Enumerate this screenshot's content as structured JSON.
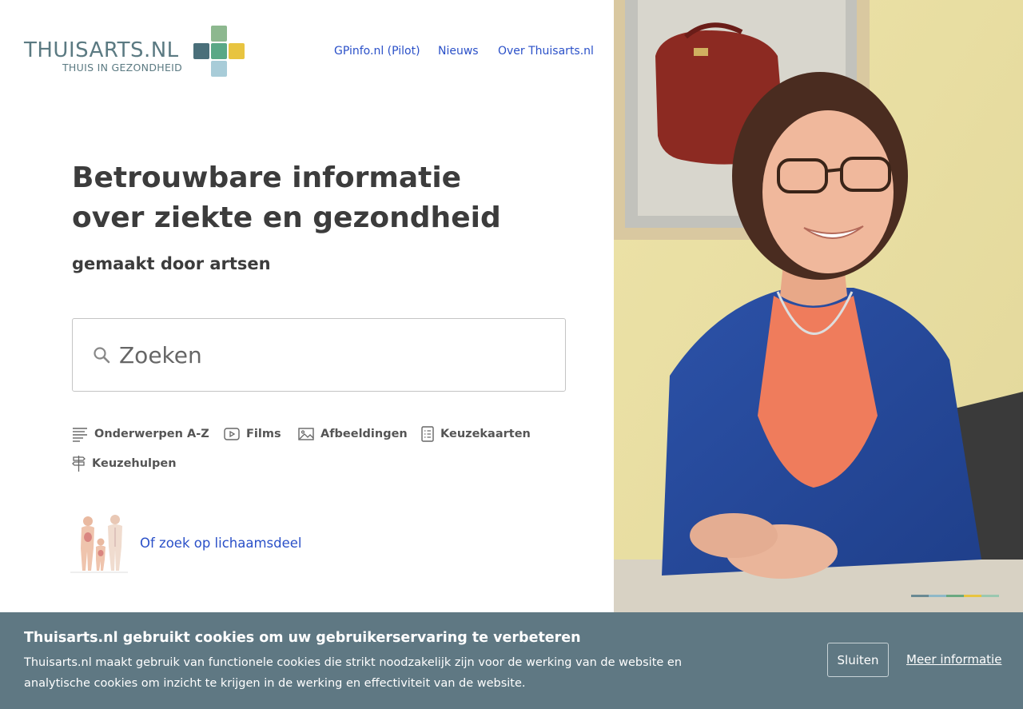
{
  "header": {
    "logo": {
      "wordmark": "THUISARTS.NL",
      "tagline": "THUIS IN GEZONDHEID",
      "cross_colors": [
        "#8db88f",
        "#4a6f7a",
        "#6fa8b8",
        "#5aa886",
        "#e8c440",
        "#a8ccd8"
      ]
    },
    "nav": [
      {
        "label": "GPinfo.nl (Pilot)"
      },
      {
        "label": "Nieuws"
      },
      {
        "label": "Over Thuisarts.nl"
      }
    ]
  },
  "hero": {
    "title_line1": "Betrouwbare informatie",
    "title_line2": "over ziekte en gezondheid",
    "subtitle": "gemaakt door artsen"
  },
  "search": {
    "placeholder": "Zoeken",
    "icon": "search-icon"
  },
  "quick_links": [
    {
      "label": "Onderwerpen A-Z",
      "icon": "list-icon"
    },
    {
      "label": "Films",
      "icon": "play-icon"
    },
    {
      "label": "Afbeeldingen",
      "icon": "image-icon"
    },
    {
      "label": "Keuzekaarten",
      "icon": "checklist-icon"
    },
    {
      "label": "Keuzehulpen",
      "icon": "signpost-icon"
    }
  ],
  "body_search": {
    "label": "Of zoek op lichaamsdeel"
  },
  "photo": {
    "alt": "doctor-portrait",
    "progress_colors": [
      "#6a8a93",
      "#8fb8c8",
      "#6aa880",
      "#e8c440",
      "#9ac8b0"
    ]
  },
  "cookie": {
    "title": "Thuisarts.nl gebruikt cookies om uw gebruikerservaring te verbeteren",
    "text": "Thuisarts.nl maakt gebruik van functionele cookies die strikt noodzakelijk zijn voor de werking van de website en analytische cookies om inzicht te krijgen in de werking en effectiviteit van de website.",
    "close_label": "Sluiten",
    "more_label": "Meer informatie"
  },
  "colors": {
    "link": "#2a50c8",
    "heading": "#3c3c3c",
    "cookie_bg": "#5f7883"
  }
}
